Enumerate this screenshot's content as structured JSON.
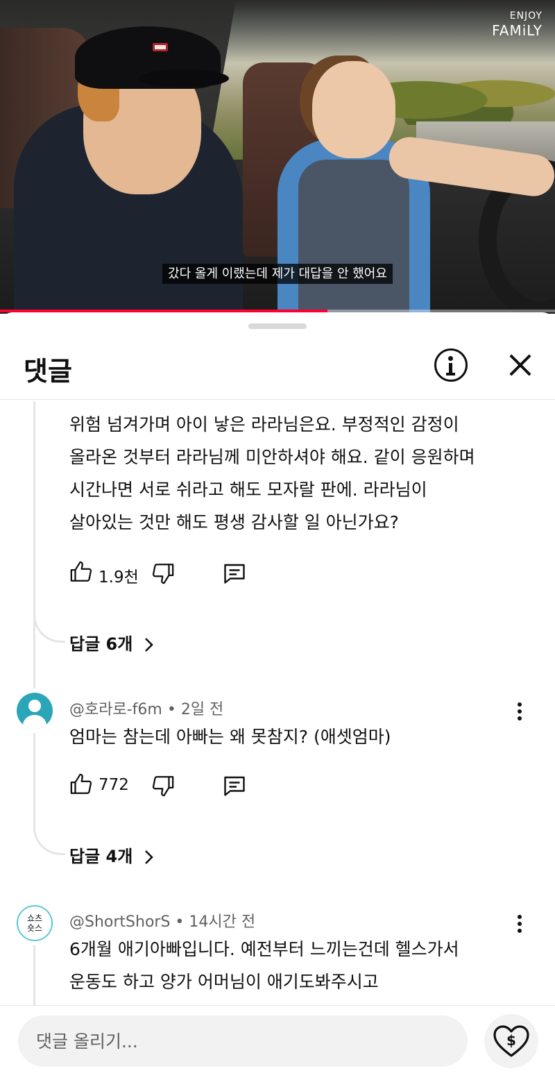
{
  "video": {
    "brand_line1": "ENJOY",
    "brand_line2": "FAMiLY",
    "subtitle": "갔다 올게 이랬는데 제가 대답을 안 했어요",
    "progress": 0.59,
    "progress_color": "#ff0033"
  },
  "sheet": {
    "title": "댓글",
    "info_icon": "info-icon",
    "close_icon": "close-icon"
  },
  "comments": [
    {
      "text_lines": [
        "위험 넘겨가며 아이 낳은 라라님은요. 부정적인 감정이",
        "올라온 것부터 라라님께 미안하셔야 해요. 같이 응원하며",
        "시간나면 서로 쉬라고 해도 모자랄 판에. 라라님이",
        "살아있는 것만 해도 평생 감사할 일 아닌가요?"
      ],
      "likes": "1.9천",
      "replies": "답글 6개"
    },
    {
      "author": "@호라로-f6m",
      "time": "2일 전",
      "text": "엄마는 참는데 아빠는 왜 못참지? (애셋엄마)",
      "likes": "772",
      "replies": "답글 4개"
    },
    {
      "author": "@ShortShorS",
      "time": "14시간 전",
      "avatar_text_line1": "쇼츠",
      "avatar_text_line2": "숏스",
      "text_lines": [
        "6개월 애기아빠입니다. 예전부터 느끼는건데 헬스가서",
        "운동도 하고 양가 어머님이 애기도봐주시고"
      ]
    }
  ],
  "input": {
    "placeholder": "댓글 올리기..."
  }
}
